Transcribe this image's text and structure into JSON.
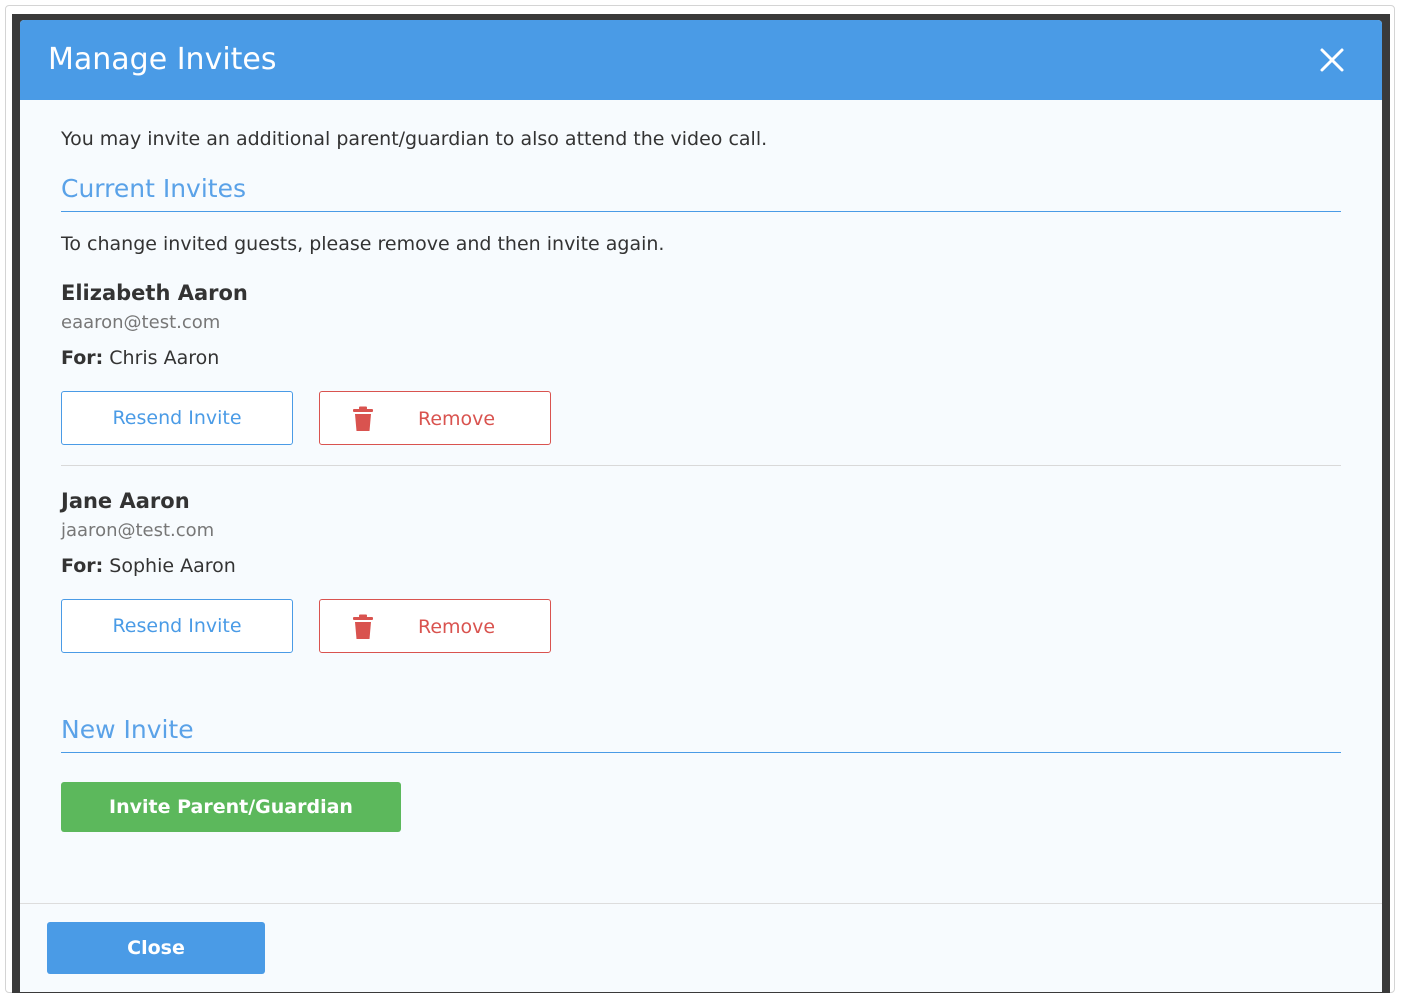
{
  "modal": {
    "title": "Manage Invites",
    "intro": "You may invite an additional parent/guardian to also attend the video call."
  },
  "current_invites": {
    "heading": "Current Invites",
    "note": "To change invited guests, please remove and then invite again.",
    "items": [
      {
        "name": "Elizabeth Aaron",
        "email": "eaaron@test.com",
        "for_label": "For:",
        "for_name": "Chris Aaron",
        "resend_label": "Resend Invite",
        "remove_label": "Remove"
      },
      {
        "name": "Jane Aaron",
        "email": "jaaron@test.com",
        "for_label": "For:",
        "for_name": "Sophie Aaron",
        "resend_label": "Resend Invite",
        "remove_label": "Remove"
      }
    ]
  },
  "new_invite": {
    "heading": "New Invite",
    "button_label": "Invite Parent/Guardian"
  },
  "footer": {
    "close_label": "Close"
  },
  "colors": {
    "primary": "#4a9be6",
    "danger": "#d9534f",
    "success": "#5cb85c"
  },
  "icons": {
    "close": "close-icon",
    "remove": "trash-icon"
  }
}
